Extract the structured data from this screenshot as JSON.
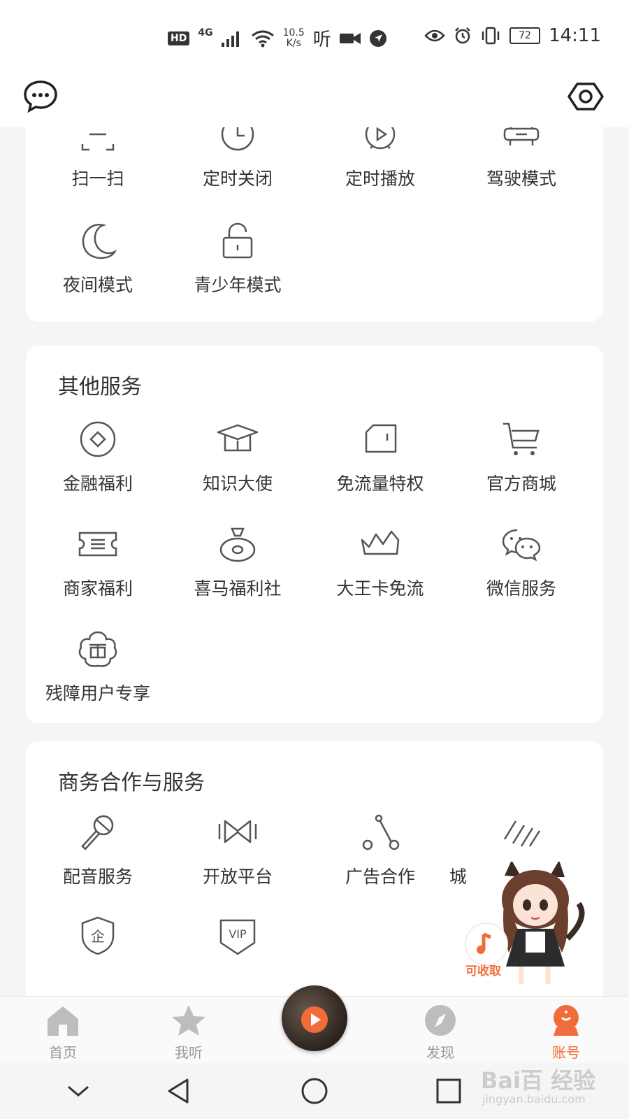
{
  "status_bar": {
    "hd": "HD",
    "network": "4G",
    "speed_value": "10.5",
    "speed_unit": "K/s",
    "ting_glyph": "听",
    "battery": "72",
    "time": "14:11"
  },
  "tools": {
    "items": [
      {
        "label": "扫一扫",
        "icon": "scan-icon"
      },
      {
        "label": "定时关闭",
        "icon": "clock-icon"
      },
      {
        "label": "定时播放",
        "icon": "alarm-play-icon"
      },
      {
        "label": "驾驶模式",
        "icon": "car-icon"
      },
      {
        "label": "夜间模式",
        "icon": "moon-icon"
      },
      {
        "label": "青少年模式",
        "icon": "lock-icon"
      }
    ]
  },
  "other_services": {
    "title": "其他服务",
    "items": [
      {
        "label": "金融福利",
        "icon": "coin-icon"
      },
      {
        "label": "知识大使",
        "icon": "graduation-cap-icon"
      },
      {
        "label": "免流量特权",
        "icon": "sim-card-icon"
      },
      {
        "label": "官方商城",
        "icon": "shopping-cart-icon"
      },
      {
        "label": "商家福利",
        "icon": "ticket-icon"
      },
      {
        "label": "喜马福利社",
        "icon": "money-bag-icon"
      },
      {
        "label": "大王卡免流",
        "icon": "crown-card-icon"
      },
      {
        "label": "微信服务",
        "icon": "wechat-icon"
      },
      {
        "label": "残障用户专享",
        "icon": "gift-flower-icon"
      }
    ]
  },
  "business": {
    "title": "商务合作与服务",
    "items": [
      {
        "label": "配音服务",
        "icon": "microphone-icon"
      },
      {
        "label": "开放平台",
        "icon": "bowtie-icon"
      },
      {
        "label": "广告合作",
        "icon": "link-nodes-icon"
      },
      {
        "label": "城",
        "icon": "stripes-icon"
      },
      {
        "label": "",
        "icon": "enterprise-shield-icon",
        "badge": "企"
      },
      {
        "label": "",
        "icon": "vip-icon",
        "badge": "VIP"
      }
    ]
  },
  "floating": {
    "collect_label": "可收取"
  },
  "bottom_nav": {
    "items": [
      {
        "label": "首页",
        "active": false
      },
      {
        "label": "我听",
        "active": false
      },
      {
        "label": "发现",
        "active": false
      },
      {
        "label": "账号",
        "active": true
      }
    ]
  },
  "watermark": {
    "brand": "Bai百 经验",
    "url": "jingyan.baidu.com"
  },
  "colors": {
    "accent": "#f26b3a",
    "icon_stroke": "#555555",
    "inactive_nav": "#bdbdbd"
  }
}
